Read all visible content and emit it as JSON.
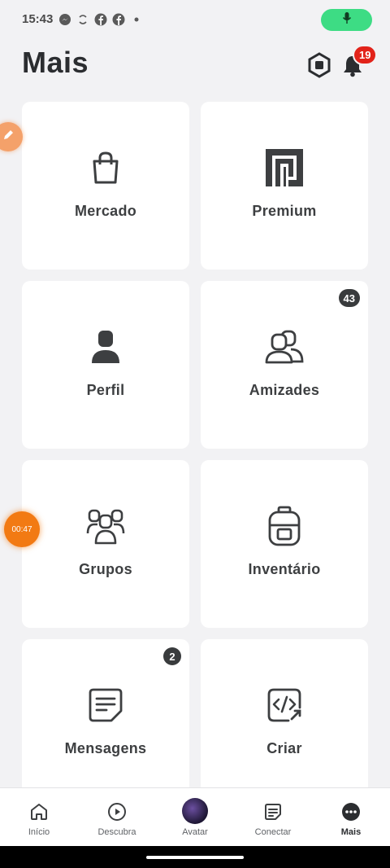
{
  "status_bar": {
    "time": "15:43",
    "mic_color": "#3ddc84"
  },
  "header": {
    "title": "Mais",
    "notification_count": "19"
  },
  "tiles": [
    {
      "label": "Mercado",
      "icon": "shopping-bag-icon",
      "badge": ""
    },
    {
      "label": "Premium",
      "icon": "premium-icon",
      "badge": ""
    },
    {
      "label": "Perfil",
      "icon": "profile-icon",
      "badge": ""
    },
    {
      "label": "Amizades",
      "icon": "friends-icon",
      "badge": "43"
    },
    {
      "label": "Grupos",
      "icon": "groups-icon",
      "badge": ""
    },
    {
      "label": "Inventário",
      "icon": "backpack-icon",
      "badge": ""
    },
    {
      "label": "Mensagens",
      "icon": "messages-icon",
      "badge": "2"
    },
    {
      "label": "Criar",
      "icon": "create-icon",
      "badge": ""
    }
  ],
  "overlay": {
    "timer": "00:47"
  },
  "bottom_nav": {
    "items": [
      {
        "label": "Início",
        "icon": "home-icon"
      },
      {
        "label": "Descubra",
        "icon": "play-icon"
      },
      {
        "label": "Avatar",
        "icon": "avatar"
      },
      {
        "label": "Conectar",
        "icon": "chat-icon"
      },
      {
        "label": "Mais",
        "icon": "more-icon"
      }
    ],
    "active": "Mais"
  },
  "colors": {
    "background": "#f2f2f4",
    "tile": "#ffffff",
    "badge_red": "#e2231a",
    "badge_dark": "#393b3d",
    "timer_orange": "#f27a13"
  }
}
